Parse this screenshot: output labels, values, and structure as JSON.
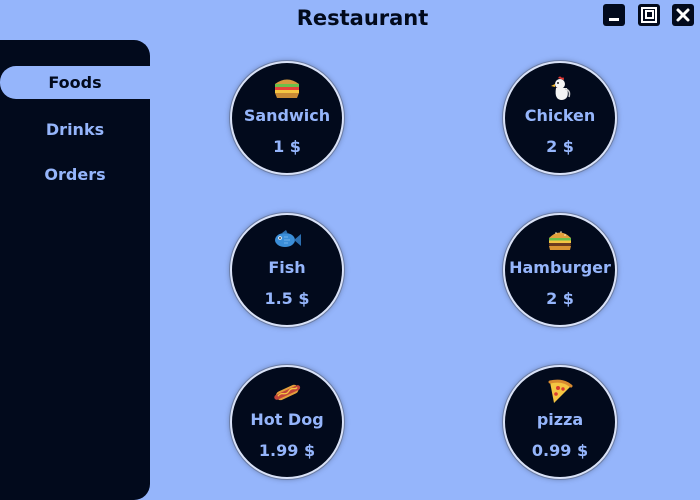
{
  "window": {
    "title": "Restaurant",
    "controls": [
      "minimize-icon",
      "maximize-icon",
      "close-icon"
    ]
  },
  "sidebar": {
    "items": [
      {
        "label": "Foods",
        "active": true
      },
      {
        "label": "Drinks",
        "active": false
      },
      {
        "label": "Orders",
        "active": false
      }
    ]
  },
  "foods": [
    {
      "icon": "sandwich-icon",
      "name": "Sandwich",
      "price": "1 $"
    },
    {
      "icon": "chicken-icon",
      "name": "Chicken",
      "price": "2 $"
    },
    {
      "icon": "fish-icon",
      "name": "Fish",
      "price": "1.5 $"
    },
    {
      "icon": "hamburger-icon",
      "name": "Hamburger",
      "price": "2 $"
    },
    {
      "icon": "hot-dog-icon",
      "name": "Hot Dog",
      "price": "1.99 $"
    },
    {
      "icon": "pizza-icon",
      "name": "pizza",
      "price": "0.99 $"
    }
  ],
  "colors": {
    "background": "#95b5fb",
    "panel": "#020a1c",
    "text_light": "#95b5fb",
    "card_border": "#d9e2f8"
  }
}
